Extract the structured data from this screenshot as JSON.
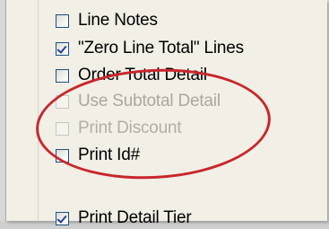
{
  "options": [
    {
      "label": "Line Notes",
      "checked": false,
      "enabled": true
    },
    {
      "label": "\"Zero Line Total\" Lines",
      "checked": true,
      "enabled": true
    },
    {
      "label": "Order Total Detail",
      "checked": false,
      "enabled": true
    },
    {
      "label": "Use Subtotal Detail",
      "checked": false,
      "enabled": false
    },
    {
      "label": "Print Discount",
      "checked": false,
      "enabled": false
    },
    {
      "label": "Print Id#",
      "checked": false,
      "enabled": true
    },
    {
      "label": "Print Detail Tier",
      "checked": true,
      "enabled": true
    }
  ],
  "annotation": {
    "color": "#c9262c"
  }
}
